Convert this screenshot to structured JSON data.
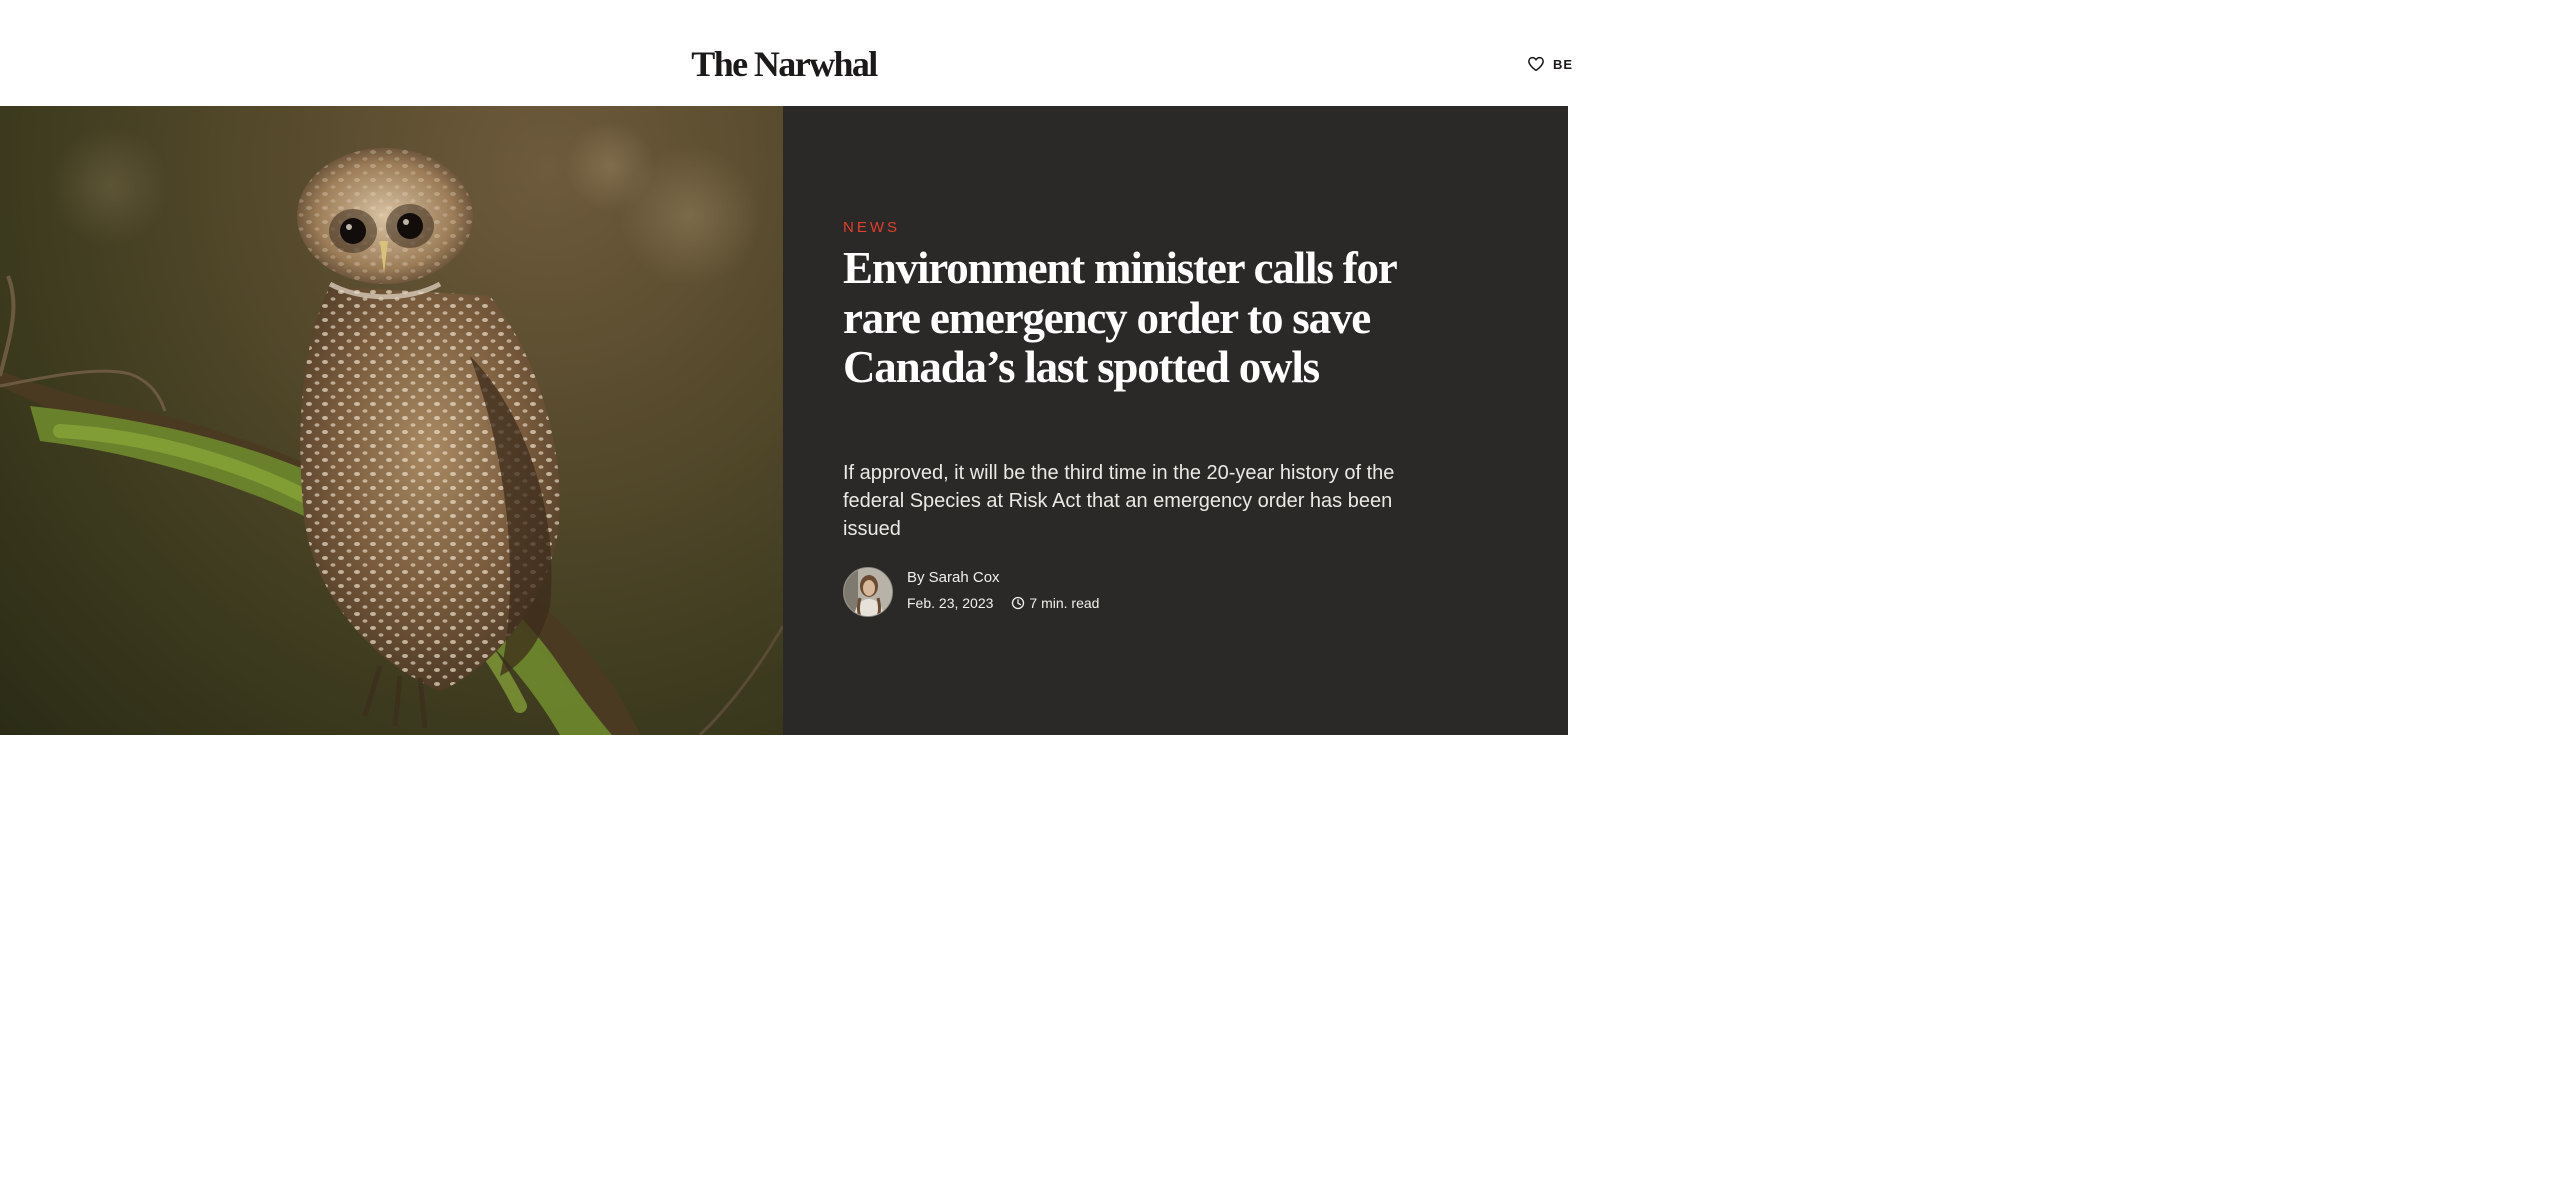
{
  "site": {
    "logo": "The Narwhal"
  },
  "header_action": {
    "label": "BE",
    "icon": "heart-outline-icon"
  },
  "article": {
    "category": "NEWS",
    "headline": "Environment minister calls for rare emergency order to save Canada’s last spotted owls",
    "dek": "If approved, it will be the third time in the 20-year history of the federal Species at Risk Act that an emergency order has been issued",
    "byline": "By Sarah Cox",
    "date": "Feb. 23, 2023",
    "read_time": "7 min. read",
    "read_time_icon": "clock-icon"
  },
  "colors": {
    "panel_bg": "#2a2927",
    "kicker": "#e23e2b",
    "headline": "#ffffff",
    "logo": "#1b1a18"
  }
}
